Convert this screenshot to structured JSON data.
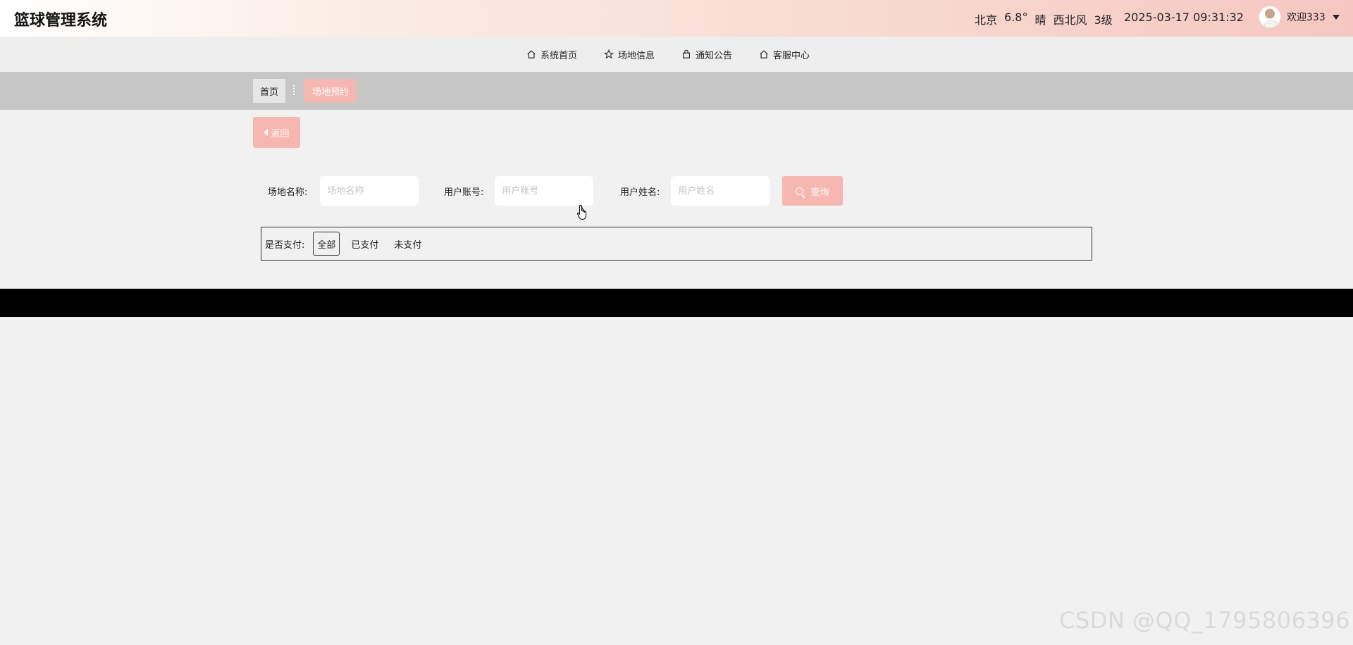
{
  "app": {
    "title": "篮球管理系统"
  },
  "header": {
    "weather": {
      "city": "北京",
      "temp": "6.8°",
      "condition": "晴",
      "wind": "西北风",
      "level": "3级"
    },
    "datetime": "2025-03-17 09:31:32",
    "user": {
      "welcome": "欢迎333"
    }
  },
  "nav": {
    "items": [
      {
        "label": "系统首页",
        "icon": "home-icon"
      },
      {
        "label": "场地信息",
        "icon": "star-icon"
      },
      {
        "label": "通知公告",
        "icon": "bag-icon"
      },
      {
        "label": "客服中心",
        "icon": "home-icon"
      }
    ]
  },
  "breadcrumb": {
    "home": "首页",
    "current": "场地预约"
  },
  "back": {
    "label": "返回"
  },
  "search": {
    "venue_label": "场地名称:",
    "venue_placeholder": "场地名称",
    "account_label": "用户账号:",
    "account_placeholder": "用户账号",
    "name_label": "用户姓名:",
    "name_placeholder": "用户姓名",
    "query_label": "查询"
  },
  "pay_filter": {
    "label": "是否支付:",
    "options": [
      "全部",
      "已支付",
      "未支付"
    ],
    "selected": "全部"
  },
  "watermark": "CSDN @QQ_1795806396",
  "colors": {
    "accent": "#f5b7b0",
    "crumb_band": "#c6c6c6",
    "footer": "#000000"
  }
}
